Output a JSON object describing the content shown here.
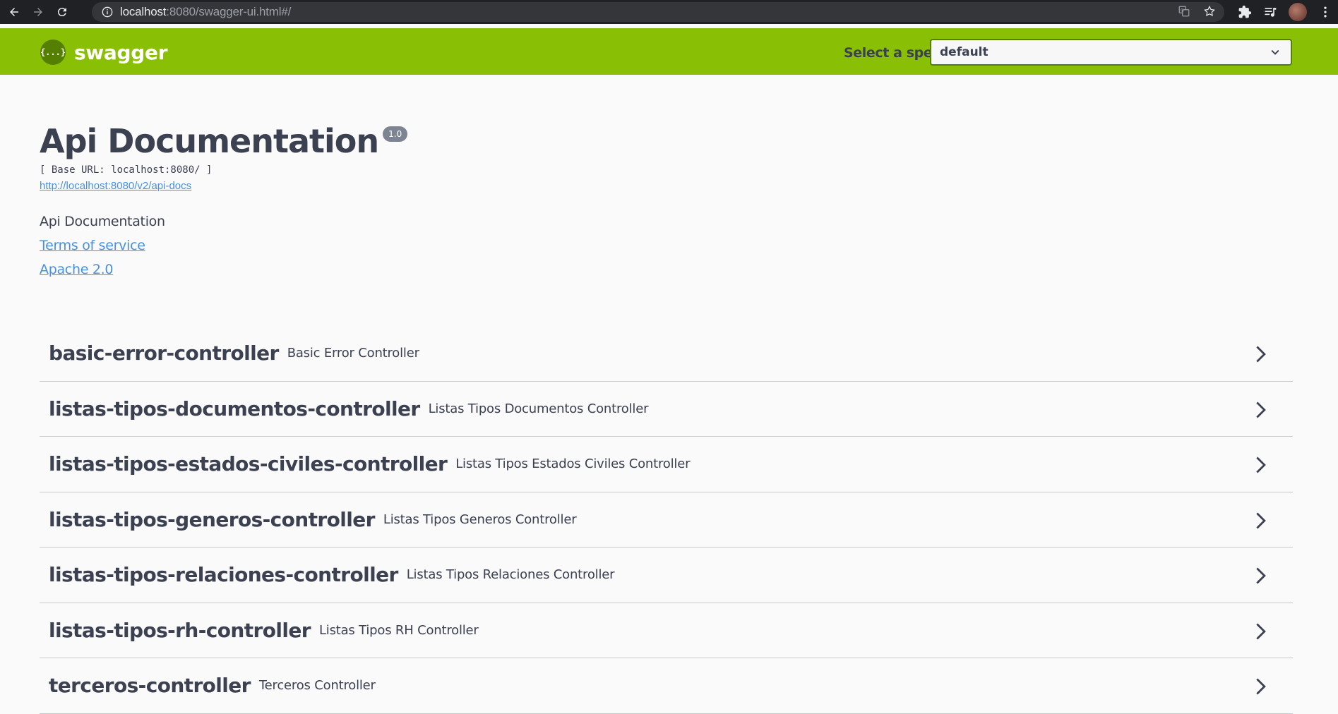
{
  "browser": {
    "url_host": "localhost",
    "url_rest": ":8080/swagger-ui.html#/"
  },
  "topbar": {
    "logo_glyph": "{...}",
    "logo_text": "swagger",
    "spec_label": "Select a spec",
    "spec_value": "default"
  },
  "info": {
    "title": "Api Documentation",
    "version": "1.0",
    "base_url": "[ Base URL: localhost:8080/ ]",
    "spec_link": "http://localhost:8080/v2/api-docs",
    "description": "Api Documentation",
    "terms": "Terms of service",
    "license": "Apache 2.0"
  },
  "controllers": [
    {
      "name": "basic-error-controller",
      "desc": "Basic Error Controller"
    },
    {
      "name": "listas-tipos-documentos-controller",
      "desc": "Listas Tipos Documentos Controller"
    },
    {
      "name": "listas-tipos-estados-civiles-controller",
      "desc": "Listas Tipos Estados Civiles Controller"
    },
    {
      "name": "listas-tipos-generos-controller",
      "desc": "Listas Tipos Generos Controller"
    },
    {
      "name": "listas-tipos-relaciones-controller",
      "desc": "Listas Tipos Relaciones Controller"
    },
    {
      "name": "listas-tipos-rh-controller",
      "desc": "Listas Tipos RH Controller"
    },
    {
      "name": "terceros-controller",
      "desc": "Terceros Controller"
    }
  ],
  "colors": {
    "topbar": "#89bf04",
    "link": "#4990e2",
    "text": "#3b4151"
  }
}
